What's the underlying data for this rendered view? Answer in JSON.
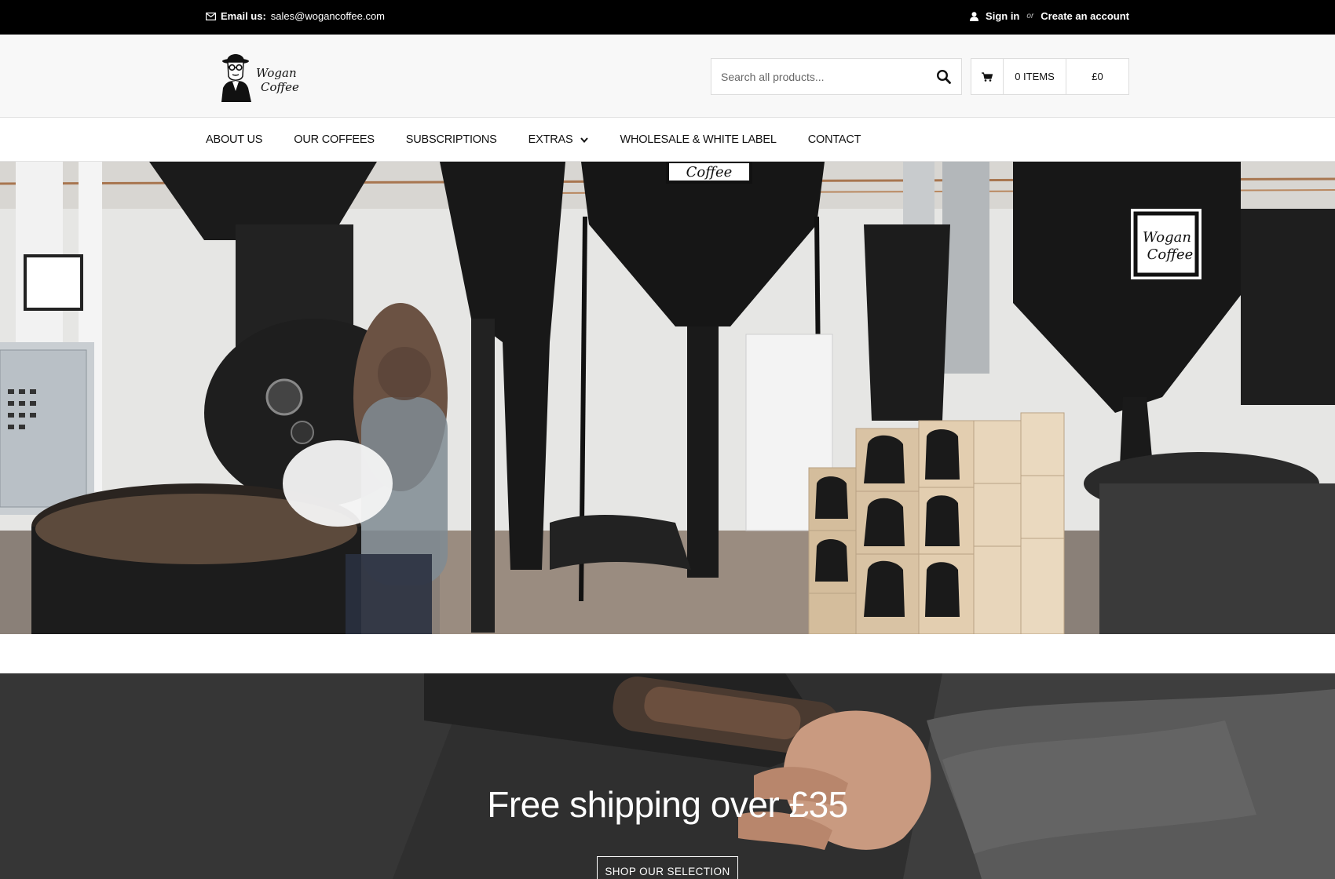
{
  "topbar": {
    "email_label": "Email us:",
    "email_value": "sales@wogancoffee.com",
    "sign_in": "Sign in",
    "or": "or",
    "create_account": "Create an account"
  },
  "logo": {
    "line1": "Wogan",
    "line2": "Coffee"
  },
  "search": {
    "placeholder": "Search all products..."
  },
  "cart": {
    "items": "0 ITEMS",
    "total": "£0"
  },
  "nav": {
    "items": [
      {
        "label": "ABOUT US"
      },
      {
        "label": "OUR COFFEES"
      },
      {
        "label": "SUBSCRIPTIONS"
      },
      {
        "label": "EXTRAS"
      },
      {
        "label": "WHOLESALE & WHITE LABEL"
      },
      {
        "label": "CONTACT"
      }
    ]
  },
  "hero": {
    "badge_line1": "Wogan",
    "badge_line2": "Coffee",
    "top_badge": "Coffee"
  },
  "promo": {
    "title": "Free shipping over £35",
    "button": "SHOP OUR SELECTION"
  },
  "colors": {
    "topbar_bg": "#000000",
    "header_bg": "#f8f8f8",
    "accent_text": "#ffffff"
  }
}
